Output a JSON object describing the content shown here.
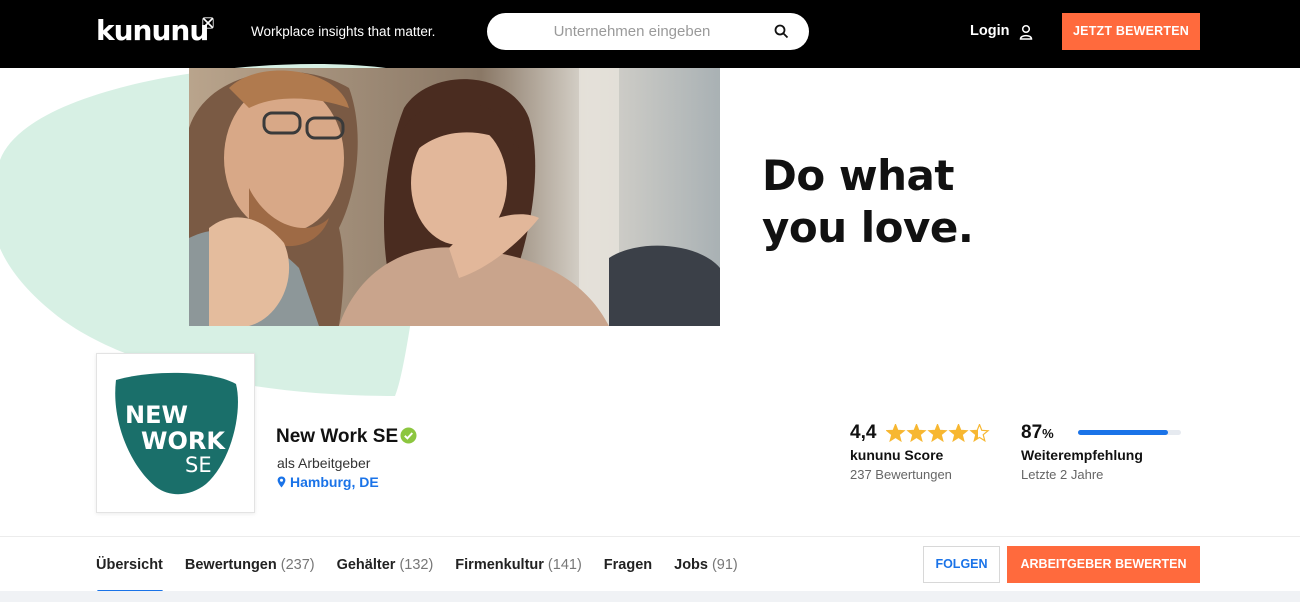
{
  "header": {
    "logo_text": "kununu",
    "tagline": "Workplace insights that matter.",
    "search_placeholder": "Unternehmen eingeben",
    "login_label": "Login",
    "cta_label": "JETZT BEWERTEN"
  },
  "hero": {
    "slogan_line1": "Do what",
    "slogan_line2": "you love."
  },
  "company": {
    "logo_text_line1": "NEW",
    "logo_text_line2": "WORK",
    "logo_text_line3": "SE",
    "name": "New Work SE",
    "subtitle": "als Arbeitgeber",
    "location": "Hamburg, DE"
  },
  "score": {
    "value": "4,4",
    "rating": 4.4,
    "label": "kununu Score",
    "count_text": "237 Bewertungen"
  },
  "recommendation": {
    "value": "87",
    "unit": "%",
    "fraction": 0.87,
    "label": "Weiterempfehlung",
    "period": "Letzte 2 Jahre"
  },
  "tabs": [
    {
      "label": "Übersicht",
      "count": ""
    },
    {
      "label": "Bewertungen",
      "count": "(237)"
    },
    {
      "label": "Gehälter",
      "count": "(132)"
    },
    {
      "label": "Firmenkultur",
      "count": "(141)"
    },
    {
      "label": "Fragen",
      "count": ""
    },
    {
      "label": "Jobs",
      "count": "(91)"
    }
  ],
  "actions": {
    "follow_label": "FOLGEN",
    "rate_label": "ARBEITGEBER BEWERTEN"
  },
  "colors": {
    "accent_orange": "#ff6a3d",
    "accent_blue": "#1a73e8",
    "star": "#f7b731",
    "brand_teal": "#1a6f6a",
    "mint": "#d7f0e4",
    "verified": "#8cc63f"
  },
  "icons": [
    "logo-mark-icon",
    "search-icon",
    "user-icon",
    "verified-icon",
    "pin-icon",
    "star-icon"
  ]
}
